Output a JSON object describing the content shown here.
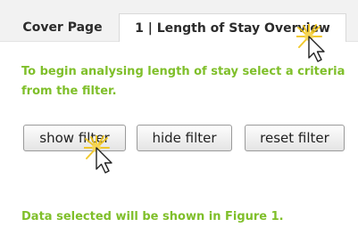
{
  "tabs": [
    {
      "label": "Cover Page"
    },
    {
      "label": "1 | Length of Stay Overview"
    }
  ],
  "instruction": "To begin analysing length of stay select a criteria from the filter.",
  "buttons": {
    "show": "show filter",
    "hide": "hide filter",
    "reset": "reset filter"
  },
  "footer_note": "Data selected will be shown in Figure 1.",
  "colors": {
    "accent_text": "#7fbf2a",
    "cursor_glow": "#f0c419"
  },
  "icons": {
    "cursor": "mouse-pointer-icon"
  }
}
